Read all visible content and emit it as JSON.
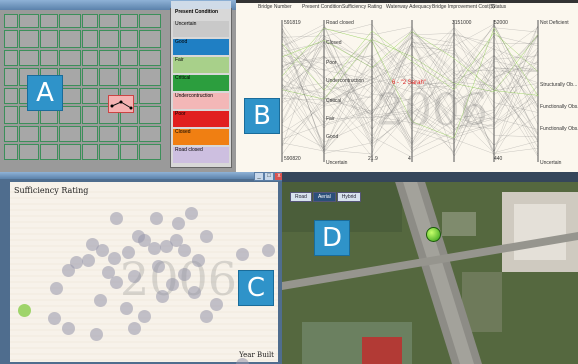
{
  "panel_a": {
    "badge": "A",
    "legend": {
      "title": "Present Condition",
      "items": [
        {
          "label": "Uncertain",
          "color": "#c9c9c9"
        },
        {
          "label": "Good",
          "color": "#1f7fc4"
        },
        {
          "label": "Fair",
          "color": "#a8d08a"
        },
        {
          "label": "Critical",
          "color": "#2c9e3e"
        },
        {
          "label": "Undercontruction",
          "color": "#f3b7b7"
        },
        {
          "label": "Poor",
          "color": "#e11f1f"
        },
        {
          "label": "Closed",
          "color": "#f07f12"
        },
        {
          "label": "Road closed",
          "color": "#cdbfe0"
        }
      ]
    }
  },
  "panel_b": {
    "badge": "B",
    "year_watermark": "2006",
    "headers": [
      "Bridge Number",
      "Present Condition",
      "Sufficiency Rating",
      "Waterway Adequacy",
      "Bridge Improvement Cost($)",
      "Status"
    ],
    "axis_labels": {
      "bridge_top": "591819",
      "bridge_bottom": "590820",
      "condition": [
        "Road closed",
        "Closed",
        "Poor",
        "Undercontruction",
        "Critical",
        "Fair",
        "Good",
        "Uncertain"
      ],
      "sufficiency_bottom": "21.9",
      "waterway_bottom": "4",
      "cost_top": "3151000",
      "cost2_top": "52000",
      "cost2_bottom": "440",
      "status": [
        "Not Deficient",
        "Structurally Ob...",
        "Functionally Obs...",
        "Functionally Obs...",
        "Uncertain"
      ]
    },
    "highlight": "6 - \"2 Sarah\""
  },
  "panel_c": {
    "badge": "C",
    "title": "Sufficiency Rating",
    "year_watermark": "2006",
    "xlabel": "Year Built"
  },
  "panel_d": {
    "badge": "D",
    "map_tabs": [
      "Road",
      "Aerial",
      "Hybrid"
    ]
  }
}
